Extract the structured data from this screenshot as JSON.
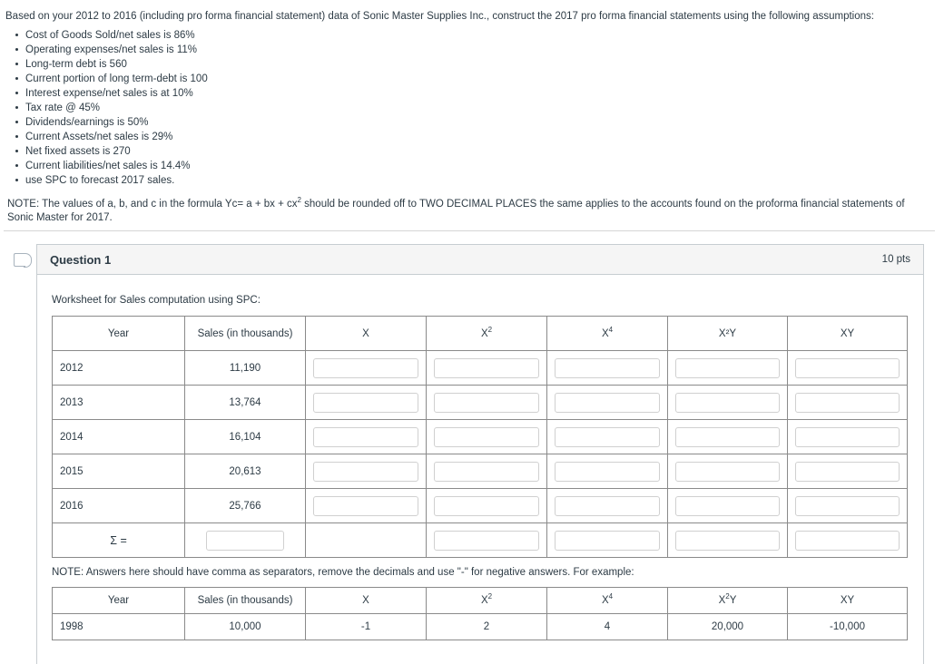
{
  "intro": {
    "lead": "Based on your 2012 to 2016 (including pro forma financial statement) data of Sonic Master Supplies Inc., construct the 2017 pro forma financial statements using the following assumptions:",
    "assumptions": [
      "Cost of Goods Sold/net sales is 86%",
      "Operating expenses/net sales is 11%",
      "Long-term debt is 560",
      "Current portion of long term-debt is 100",
      "Interest expense/net sales is at 10%",
      "Tax rate @ 45%",
      "Dividends/earnings is 50%",
      "Current Assets/net sales is 29%",
      "Net fixed assets is 270",
      "Current liabilities/net sales is 14.4%",
      "use SPC to forecast 2017 sales."
    ],
    "note_prefix": "NOTE: The values of a, b, and c in the formula Yc= a + bx + cx",
    "note_sup": "2",
    "note_suffix": " should be rounded off to TWO DECIMAL PLACES the same applies to the accounts found on the proforma financial statements of Sonic Master for 2017."
  },
  "question": {
    "flag_icon": "bookmark-flag-icon",
    "title": "Question 1",
    "points": "10 pts",
    "worksheet_label": "Worksheet for Sales computation using SPC:",
    "note_mid": "NOTE: Answers here should have comma as separators, remove the decimals and use \"-\" for negative answers. For example:"
  },
  "worksheet_table": {
    "headers": [
      {
        "text": "Year",
        "sup": ""
      },
      {
        "text": "Sales (in thousands)",
        "sup": ""
      },
      {
        "text": "X",
        "sup": ""
      },
      {
        "text": "X",
        "sup": "2"
      },
      {
        "text": "X",
        "sup": "4"
      },
      {
        "text": "X²Y",
        "sup": ""
      },
      {
        "text": "XY",
        "sup": ""
      }
    ],
    "header_x2y_base": "X",
    "header_x2y_sup": "2",
    "header_x2y_tail": "Y",
    "rows": [
      {
        "year": "2012",
        "sales": "11,190"
      },
      {
        "year": "2013",
        "sales": "13,764"
      },
      {
        "year": "2014",
        "sales": "16,104"
      },
      {
        "year": "2015",
        "sales": "20,613"
      },
      {
        "year": "2016",
        "sales": "25,766"
      }
    ],
    "sum_label": "Σ =",
    "input_placeholder": ""
  },
  "example_table": {
    "headers": [
      "Year",
      "Sales (in thousands)",
      "X",
      "X2",
      "X4",
      "X2Y",
      "XY"
    ],
    "row": {
      "year": "1998",
      "sales": "10,000",
      "x": "-1",
      "x2": "2",
      "x4": "4",
      "x2y": "20,000",
      "xy": "-10,000"
    }
  },
  "colors": {
    "text": "#2d3b45",
    "card_border": "#c7cdd1",
    "header_bg": "#f5f5f5",
    "table_border": "#8a8a8a",
    "input_border": "#d0d0d0"
  }
}
